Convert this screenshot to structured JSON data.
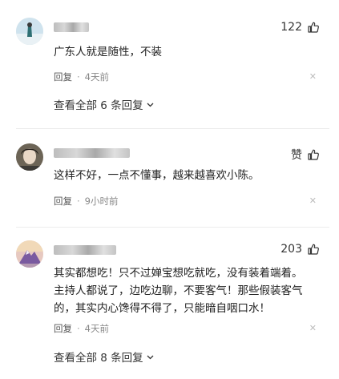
{
  "comments": [
    {
      "like_label": "122",
      "text": "广东人就是随性，不装",
      "reply_label": "回复",
      "time": "4天前",
      "close_glyph": "✕",
      "see_all_label": "查看全部 6 条回复"
    },
    {
      "like_label": "赞",
      "text": "这样不好，一点不懂事，越来越喜欢小陈。",
      "reply_label": "回复",
      "time": "9小时前",
      "close_glyph": "✕"
    },
    {
      "like_label": "203",
      "text": "其实都想吃！只不过婵宝想吃就吃，没有装着端着。\n主持人都说了，边吃边聊，不要客气！那些假装客气\n的，其实内心馋得不得了，只能暗自咽口水！",
      "reply_label": "回复",
      "time": "4天前",
      "close_glyph": "✕",
      "see_all_label": "查看全部 8 条回复"
    }
  ],
  "meta_separator": "·",
  "colors": {
    "text": "#222222",
    "meta": "#888888",
    "divider": "#ececec"
  },
  "icons": {
    "like": "thumbs-up-icon",
    "close": "close-icon",
    "expand": "chevron-down-icon"
  }
}
